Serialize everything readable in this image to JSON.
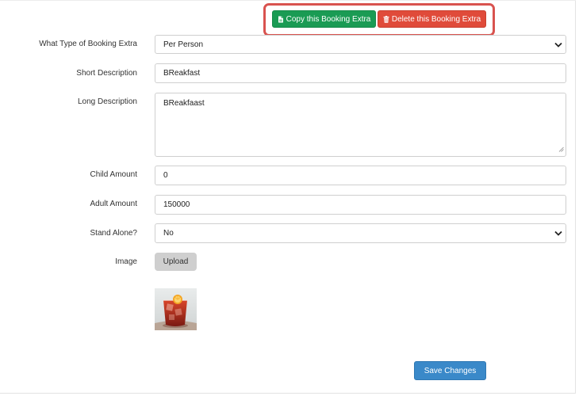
{
  "actions": {
    "copy_label": "Copy this Booking Extra",
    "delete_label": "Delete this Booking Extra"
  },
  "form": {
    "type": {
      "label": "What Type of Booking Extra",
      "value": "Per Person"
    },
    "short_description": {
      "label": "Short Description",
      "value": "BReakfast"
    },
    "long_description": {
      "label": "Long Description",
      "value": "BReakfaast"
    },
    "child_amount": {
      "label": "Child Amount",
      "value": "0"
    },
    "adult_amount": {
      "label": "Adult Amount",
      "value": "150000"
    },
    "stand_alone": {
      "label": "Stand Alone?",
      "value": "No"
    },
    "image": {
      "label": "Image",
      "upload_label": "Upload"
    }
  },
  "save_label": "Save Changes",
  "colors": {
    "copy_button": "#1a9b54",
    "delete_button": "#e04b3a",
    "save_button": "#3a89c9",
    "highlight": "#d9534f"
  },
  "icons": {
    "copy": "file-icon",
    "delete": "trash-icon",
    "select": "chevron-down-icon"
  }
}
